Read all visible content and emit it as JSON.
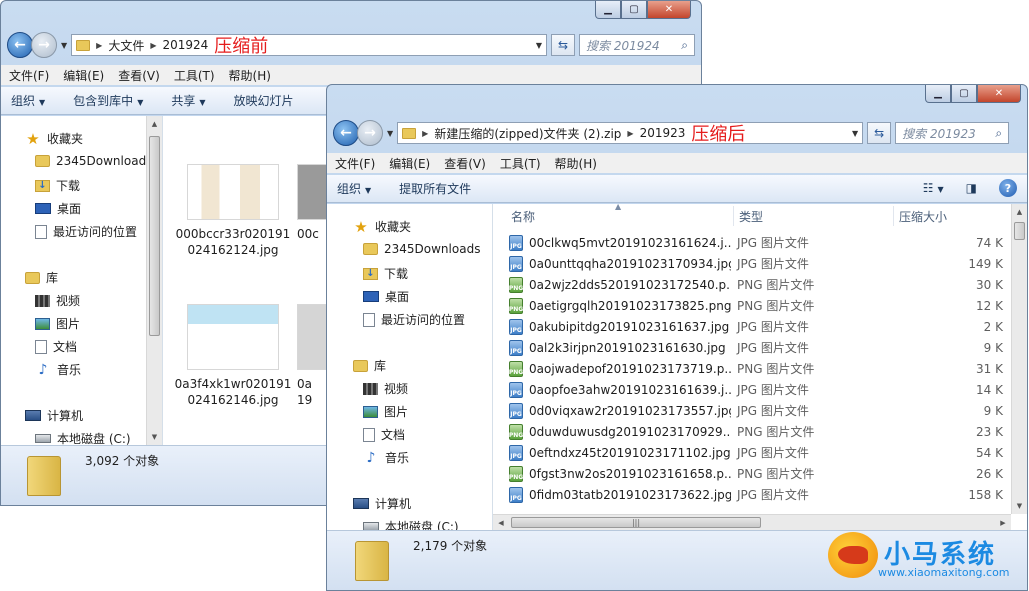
{
  "win1": {
    "address": {
      "crumbs": [
        "大文件",
        "201924"
      ],
      "note": "压缩前"
    },
    "search_placeholder": "搜索 201924",
    "menu": [
      "文件(F)",
      "编辑(E)",
      "查看(V)",
      "工具(T)",
      "帮助(H)"
    ],
    "commands": [
      "组织",
      "包含到库中",
      "共享",
      "放映幻灯片"
    ],
    "nav": {
      "favorites": "收藏夹",
      "fav_items": [
        "2345Downloads",
        "下载",
        "桌面",
        "最近访问的位置"
      ],
      "libraries": "库",
      "lib_items": [
        "视频",
        "图片",
        "文档",
        "音乐"
      ],
      "computer": "计算机",
      "drives": [
        "本地磁盘 (C:)"
      ]
    },
    "thumbs": [
      {
        "label": "000bccr33r020191024162124.jpg"
      },
      {
        "label": "00c"
      },
      {
        "label": "0a3f4xk1wr020191024162146.jpg"
      },
      {
        "label": "0a"
      }
    ],
    "thumb_label_19": "19",
    "status": "3,092 个对象"
  },
  "win2": {
    "address": {
      "crumbs": [
        "新建压缩的(zipped)文件夹 (2).zip",
        "201923"
      ],
      "note": "压缩后"
    },
    "search_placeholder": "搜索 201923",
    "menu": [
      "文件(F)",
      "编辑(E)",
      "查看(V)",
      "工具(T)",
      "帮助(H)"
    ],
    "commands": [
      "组织",
      "提取所有文件"
    ],
    "nav": {
      "favorites": "收藏夹",
      "fav_items": [
        "2345Downloads",
        "下载",
        "桌面",
        "最近访问的位置"
      ],
      "libraries": "库",
      "lib_items": [
        "视频",
        "图片",
        "文档",
        "音乐"
      ],
      "computer": "计算机",
      "drives": [
        "本地磁盘 (C:)"
      ]
    },
    "columns": [
      "名称",
      "类型",
      "压缩大小"
    ],
    "files": [
      {
        "name": "00clkwq5mvt20191023161624.j...",
        "type": "JPG 图片文件",
        "size": "74 K",
        "kind": "jpg"
      },
      {
        "name": "0a0unttqqha20191023170934.jpg",
        "type": "JPG 图片文件",
        "size": "149 K",
        "kind": "jpg"
      },
      {
        "name": "0a2wjz2dds520191023172540.p...",
        "type": "PNG 图片文件",
        "size": "30 K",
        "kind": "png"
      },
      {
        "name": "0aetigrgqlh20191023173825.png",
        "type": "PNG 图片文件",
        "size": "12 K",
        "kind": "png"
      },
      {
        "name": "0akubipitdg20191023161637.jpg",
        "type": "JPG 图片文件",
        "size": "2 K",
        "kind": "jpg"
      },
      {
        "name": "0al2k3irjpn20191023161630.jpg",
        "type": "JPG 图片文件",
        "size": "9 K",
        "kind": "jpg"
      },
      {
        "name": "0aojwadepof20191023173719.p...",
        "type": "PNG 图片文件",
        "size": "31 K",
        "kind": "png"
      },
      {
        "name": "0aopfoe3ahw20191023161639.j...",
        "type": "JPG 图片文件",
        "size": "14 K",
        "kind": "jpg"
      },
      {
        "name": "0d0viqxaw2r20191023173557.jpg",
        "type": "JPG 图片文件",
        "size": "9 K",
        "kind": "jpg"
      },
      {
        "name": "0duwduwusdg20191023170929....",
        "type": "PNG 图片文件",
        "size": "23 K",
        "kind": "png"
      },
      {
        "name": "0eftndxz45t20191023171102.jpg",
        "type": "JPG 图片文件",
        "size": "54 K",
        "kind": "jpg"
      },
      {
        "name": "0fgst3nw2os20191023161658.p...",
        "type": "PNG 图片文件",
        "size": "26 K",
        "kind": "png"
      },
      {
        "name": "0fidm03tatb20191023173622.jpg",
        "type": "JPG 图片文件",
        "size": "158 K",
        "kind": "jpg"
      }
    ],
    "status": "2,179 个对象"
  },
  "logo": {
    "name": "小马系统",
    "url": "www.xiaomaxitong.com"
  },
  "colors": {
    "note_red": "#e51c1c",
    "logo_blue": "#1c8ae2"
  }
}
